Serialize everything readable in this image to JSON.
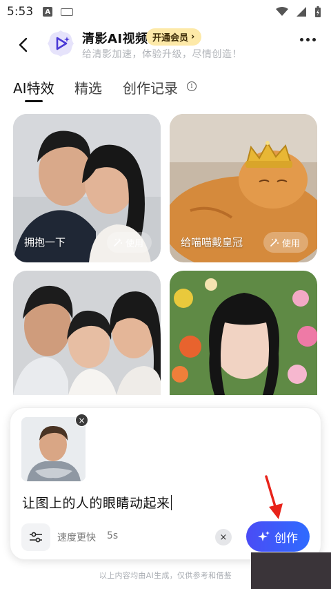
{
  "status_bar": {
    "time": "5:53",
    "a_indicator": "A"
  },
  "header": {
    "title": "清影AI视频",
    "vip_label": "开通会员",
    "vip_chevron": "›",
    "subtitle": "给清影加速，体验升级，尽情创造！"
  },
  "tabs": [
    {
      "label": "AI特效",
      "active": true
    },
    {
      "label": "精选",
      "active": false
    },
    {
      "label": "创作记录",
      "active": false
    }
  ],
  "cards": [
    {
      "label": "拥抱一下",
      "use_label": "使用"
    },
    {
      "label": "给喵喵戴皇冠",
      "use_label": "使用"
    },
    {
      "label": "",
      "use_label": ""
    },
    {
      "label": "",
      "use_label": ""
    }
  ],
  "composer": {
    "prompt": "让图上的人的眼睛动起来",
    "speed_label": "速度更快",
    "speed_value": "5s",
    "create_label": "创作",
    "close_glyph": "×"
  },
  "footer_note": "以上内容均由AI生成，仅供参考和借鉴",
  "colors": {
    "accent": "#3d5cf8",
    "vip_bg": "#fde9a8",
    "annotation": "#e8231a"
  }
}
